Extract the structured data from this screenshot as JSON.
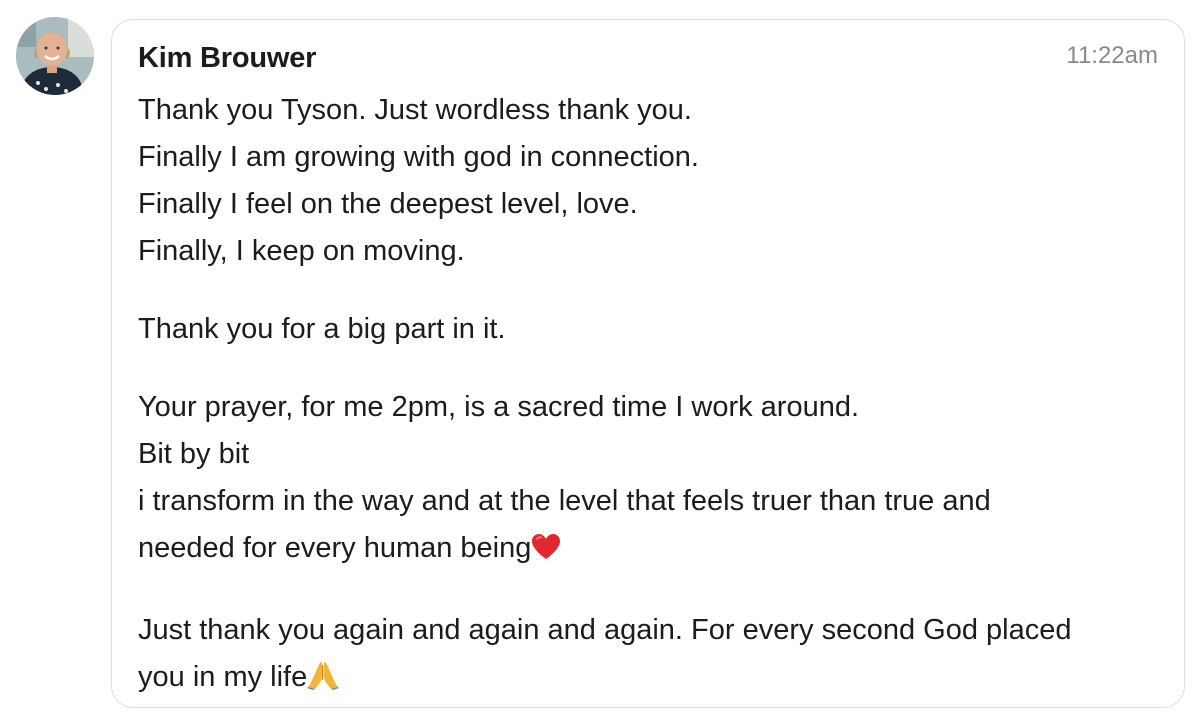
{
  "message": {
    "sender_name": "Kim Brouwer",
    "timestamp": "11:22am",
    "paragraphs": [
      {
        "lines": [
          "Thank you Tyson. Just wordless thank you.",
          "Finally I am growing with god in connection.",
          "Finally I feel on the deepest level, love.",
          "Finally, I keep on moving."
        ]
      },
      {
        "lines": [
          "Thank you for a big part in it."
        ]
      },
      {
        "lines": [
          "Your prayer, for me 2pm, is a sacred time I work around.",
          "Bit by bit",
          "i transform in the way and at the level that feels truer than true and",
          "needed for every human being"
        ],
        "trailing_icon": "red-heart-icon"
      },
      {
        "lines": [
          "Just thank you again and again and again. For every second God placed",
          "you in my life"
        ],
        "trailing_icon": "folded-hands-icon"
      }
    ]
  },
  "icons": {
    "avatar": "avatar-photo",
    "heart": "red-heart-icon",
    "pray": "folded-hands-icon"
  },
  "colors": {
    "bubble_border": "#dedede",
    "timestamp": "#8a8a8a",
    "text": "#1c1c1c",
    "heart": "#e0282e",
    "pray": "#f2b53a"
  }
}
